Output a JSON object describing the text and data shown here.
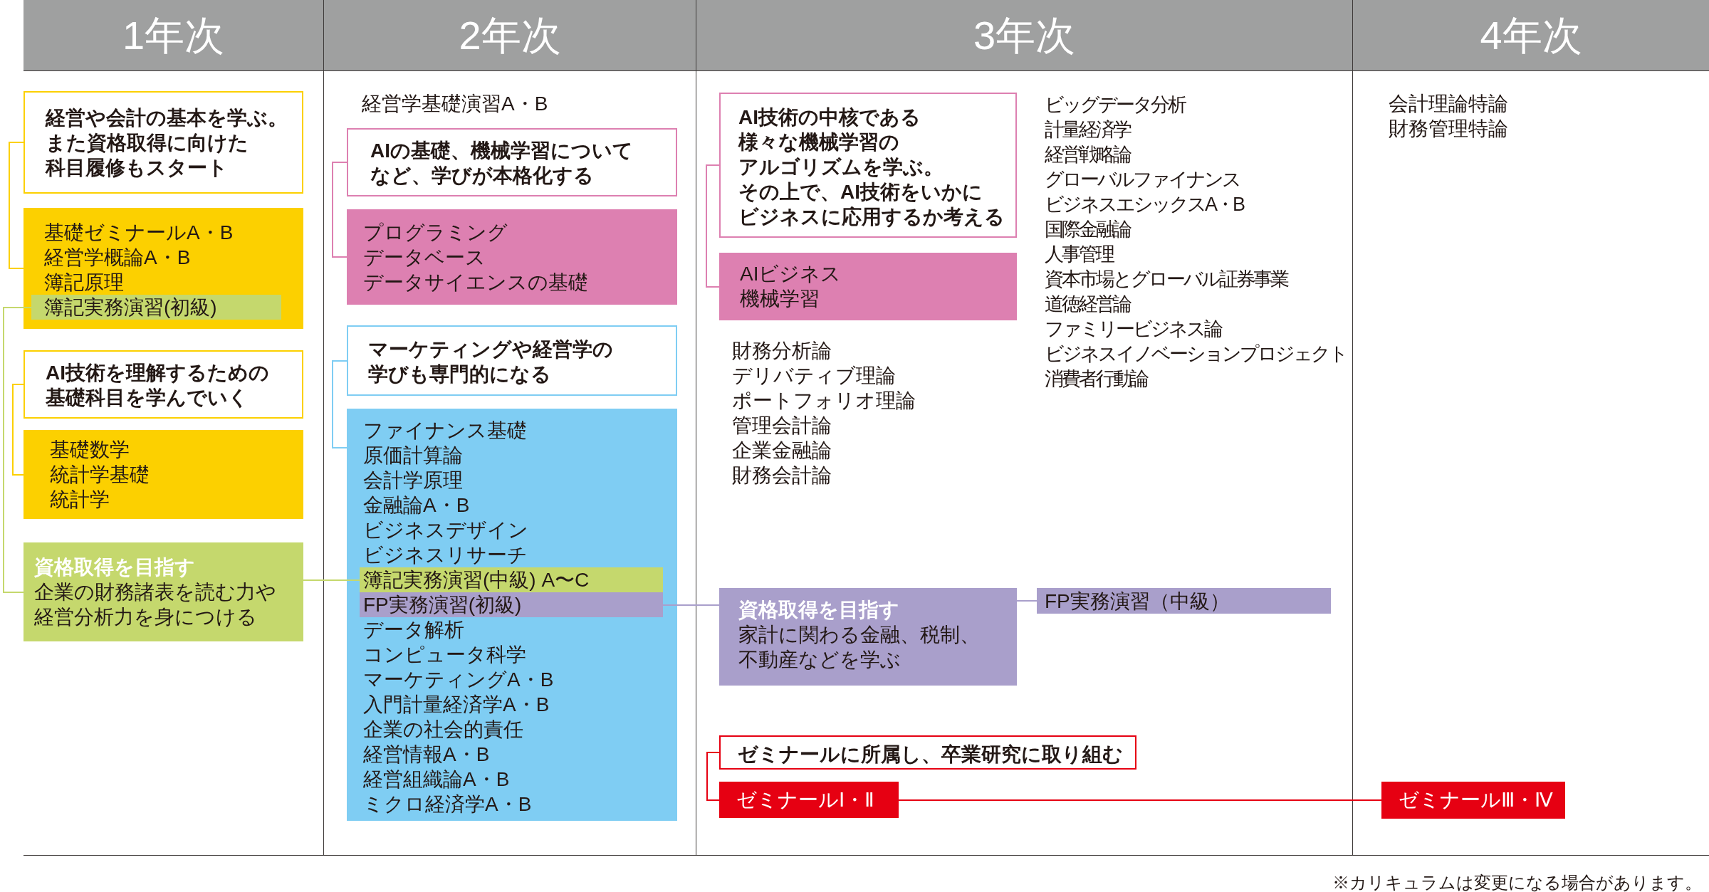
{
  "years": [
    {
      "heading": "1年次",
      "lanes": [
        {
          "groups": [
            {
              "kind": "track",
              "color": "#fcd000",
              "note": "経営や会計の基本を学ぶ。また資格取得に向けた科目履修もスタート",
              "courses": [
                {
                  "name": "基礎ゼミナールA・B"
                },
                {
                  "name": "経営学概論A・B"
                },
                {
                  "name": "簿記原理"
                },
                {
                  "name": "簿記実務演習(初級)",
                  "color": "#c5d86d"
                }
              ]
            },
            {
              "kind": "track",
              "color": "#fcd000",
              "note": "AI技術を理解するための基礎科目を学んでいく",
              "courses": [
                {
                  "name": "基礎数学"
                },
                {
                  "name": "統計学基礎"
                },
                {
                  "name": "統計学"
                }
              ]
            },
            {
              "kind": "goal",
              "color": "#c5d86d",
              "title": "資格取得を目指す",
              "text": "企業の財務諸表を読む力や経営分析力を身につける"
            }
          ]
        }
      ]
    },
    {
      "heading": "2年次",
      "lanes": [
        {
          "groups": [
            {
              "kind": "list",
              "courses": [
                {
                  "name": "経営学基礎演習A・B"
                }
              ]
            },
            {
              "kind": "track",
              "color": "#dd80b1",
              "note": "AIの基礎、機械学習についてなど、学びが本格化する",
              "courses": [
                {
                  "name": "プログラミング"
                },
                {
                  "name": "データベース"
                },
                {
                  "name": "データサイエンスの基礎"
                }
              ]
            },
            {
              "kind": "track",
              "color": "#7fcdf3",
              "note": "マーケティングや経営学の学びも専門的になる",
              "courses": [
                {
                  "name": "ファイナンス基礎"
                },
                {
                  "name": "原価計算論"
                },
                {
                  "name": "会計学原理"
                },
                {
                  "name": "金融論A・B"
                },
                {
                  "name": "ビジネスデザイン"
                },
                {
                  "name": "ビジネスリサーチ"
                },
                {
                  "name": "簿記実務演習(中級) A〜C",
                  "color": "#c5d86d"
                },
                {
                  "name": "FP実務演習(初級)",
                  "color": "#a99fcb"
                },
                {
                  "name": "データ解析"
                },
                {
                  "name": "コンピュータ科学"
                },
                {
                  "name": "マーケティングA・B"
                },
                {
                  "name": "入門計量経済学A・B"
                },
                {
                  "name": "企業の社会的責任"
                },
                {
                  "name": "経営情報A・B"
                },
                {
                  "name": "経営組織論A・B"
                },
                {
                  "name": "ミクロ経済学A・B"
                }
              ]
            }
          ]
        }
      ]
    },
    {
      "heading": "3年次",
      "lanes": [
        {
          "groups": [
            {
              "kind": "track",
              "color": "#dd80b1",
              "note": "AI技術の中核である様々な機械学習のアルゴリズムを学ぶ。その上で、AI技術をいかにビジネスに応用するか考える",
              "courses": [
                {
                  "name": "AIビジネス"
                },
                {
                  "name": "機械学習"
                }
              ]
            },
            {
              "kind": "list",
              "courses": [
                {
                  "name": "財務分析論"
                },
                {
                  "name": "デリバティブ理論"
                },
                {
                  "name": "ポートフォリオ理論"
                },
                {
                  "name": "管理会計論"
                },
                {
                  "name": "企業金融論"
                },
                {
                  "name": "財務会計論"
                }
              ]
            },
            {
              "kind": "goal",
              "color": "#a99fcb",
              "title": "資格取得を目指す",
              "text": "家計に関わる金融、税制、不動産などを学ぶ"
            },
            {
              "kind": "seminar",
              "color": "#e60012",
              "note": "ゼミナールに所属し、卒業研究に取り組む",
              "label": "ゼミナールⅠ・Ⅱ"
            }
          ]
        },
        {
          "groups": [
            {
              "kind": "list",
              "courses": [
                {
                  "name": "ビッグデータ分析"
                },
                {
                  "name": "計量経済学"
                },
                {
                  "name": "経営戦略論"
                },
                {
                  "name": "グローバルファイナンス"
                },
                {
                  "name": "ビジネスエシックスA・B"
                },
                {
                  "name": "国際金融論"
                },
                {
                  "name": "人事管理"
                },
                {
                  "name": "資本市場とグローバル証券事業"
                },
                {
                  "name": "道徳経営論"
                },
                {
                  "name": "ファミリービジネス論"
                },
                {
                  "name": "ビジネスイノベーションプロジェクト"
                },
                {
                  "name": "消費者行動論"
                }
              ]
            },
            {
              "kind": "bar",
              "color": "#a99fcb",
              "text": "FP実務演習（中級）"
            }
          ]
        }
      ]
    },
    {
      "heading": "4年次",
      "lanes": [
        {
          "groups": [
            {
              "kind": "list",
              "courses": [
                {
                  "name": "会計理論特論"
                },
                {
                  "name": "財務管理特論"
                }
              ]
            },
            {
              "kind": "label",
              "color": "#e60012",
              "text": "ゼミナールⅢ・Ⅳ"
            }
          ]
        }
      ]
    }
  ],
  "footnote": "※カリキュラムは変更になる場合があります。"
}
